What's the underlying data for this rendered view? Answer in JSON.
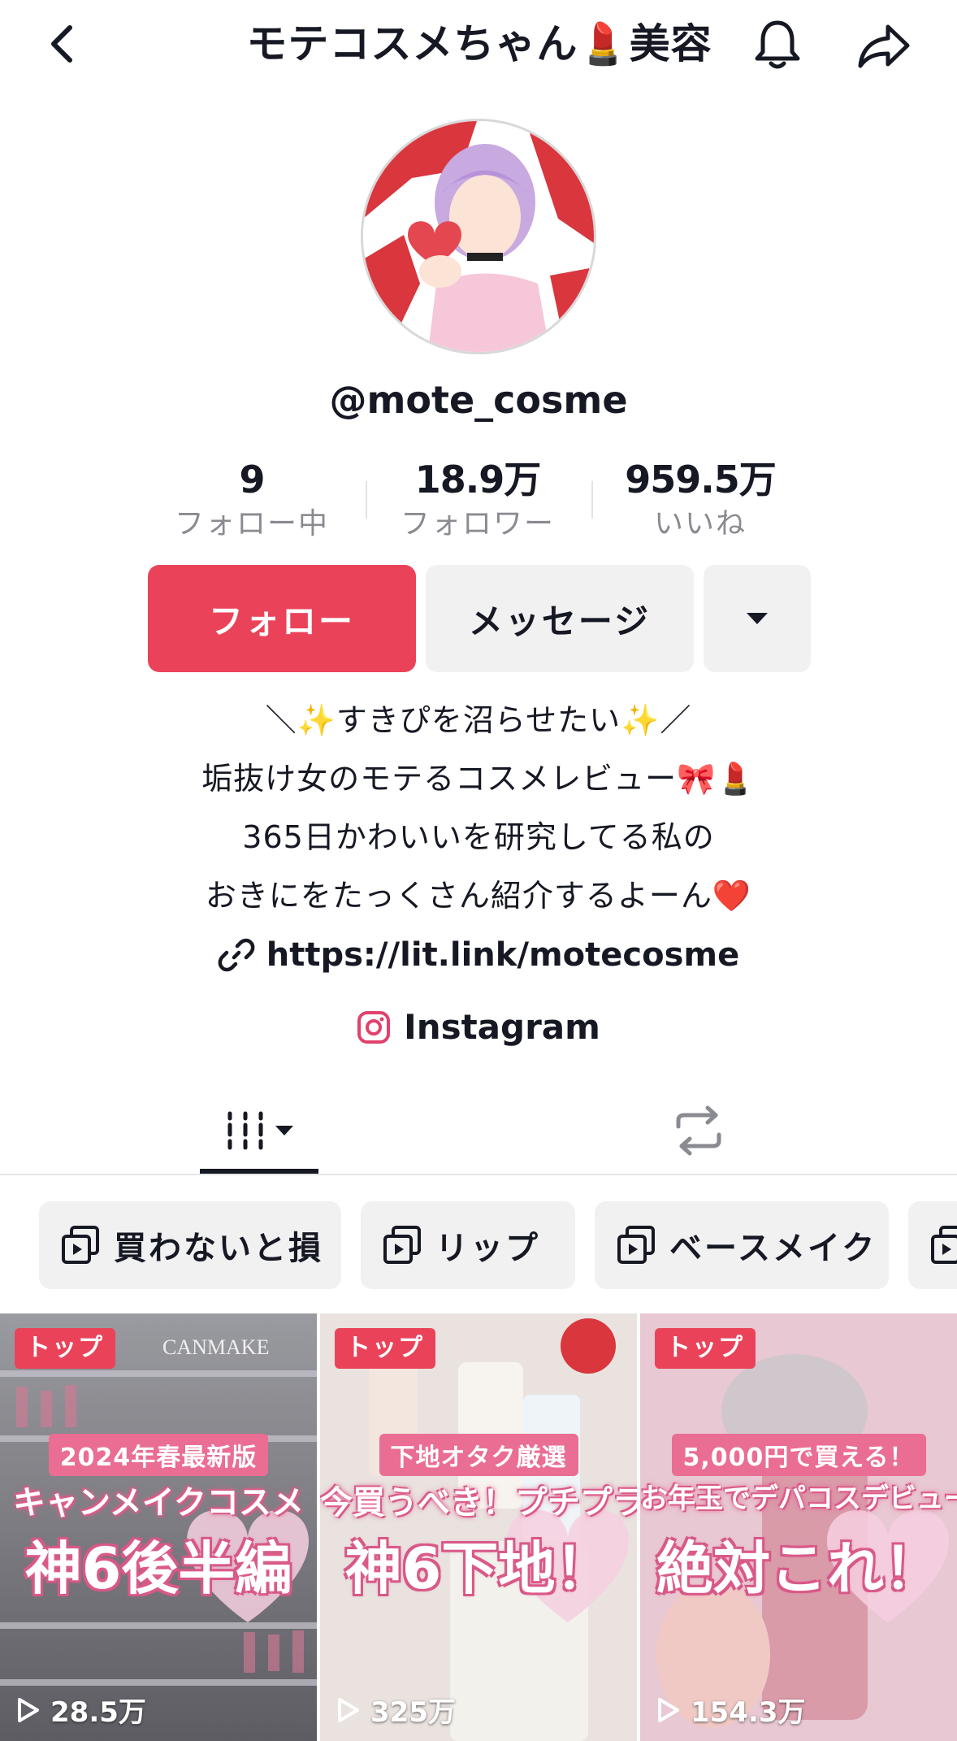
{
  "header": {
    "title": "モテコスメちゃん💄美容",
    "back_icon": "chevron-left-icon",
    "bell_icon": "bell-icon",
    "share_icon": "share-arrow-icon"
  },
  "profile": {
    "username": "@mote_cosme",
    "stats": [
      {
        "value": "9",
        "label": "フォロー中"
      },
      {
        "value": "18.9万",
        "label": "フォロワー"
      },
      {
        "value": "959.5万",
        "label": "いいね"
      }
    ],
    "follow_label": "フォロー",
    "message_label": "メッセージ",
    "bio": [
      "＼✨すきぴを沼らせたい✨／",
      "垢抜け女のモテるコスメレビュー🎀💄",
      "365日かわいいを研究してる私の",
      "おきにをたっくさん紹介するよーん❤️"
    ],
    "link": "https://lit.link/motecosme",
    "instagram_label": "Instagram"
  },
  "playlists": [
    {
      "label": "買わないと損"
    },
    {
      "label": "リップ"
    },
    {
      "label": "ベースメイク"
    }
  ],
  "videos": [
    {
      "badge": "トップ",
      "cap1": "2024年春最新版",
      "cap2": "キャンメイクコスメ",
      "cap3": "神6後半編",
      "views": "28.5万"
    },
    {
      "badge": "トップ",
      "cap1": "下地オタク厳選",
      "cap2": "今買うべき！プチプラ",
      "cap3": "神6下地！",
      "views": "325万"
    },
    {
      "badge": "トップ",
      "cap1": "5,000円で買える！",
      "cap2": "お年玉でデパコスデビュー",
      "cap3": "絶対これ！",
      "views": "154.3万"
    }
  ],
  "colors": {
    "accent": "#ea4359",
    "chip_bg": "#f1f1f2",
    "secondary_text": "#8a8b91"
  }
}
